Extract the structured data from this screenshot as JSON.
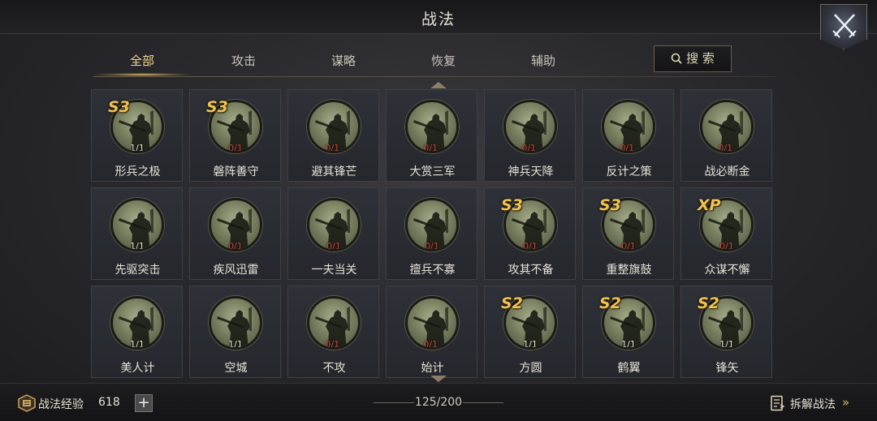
{
  "header": {
    "title": "战法"
  },
  "tabs": [
    {
      "label": "全部",
      "active": true
    },
    {
      "label": "攻击",
      "active": false
    },
    {
      "label": "谋略",
      "active": false
    },
    {
      "label": "恢复",
      "active": false
    },
    {
      "label": "辅助",
      "active": false
    }
  ],
  "search": {
    "label": "搜 索",
    "icon": "search-icon"
  },
  "close": {
    "icon": "crossed-swords-icon"
  },
  "cards": [
    {
      "name": "形兵之极",
      "count": "1/1",
      "badge": "S3"
    },
    {
      "name": "磐阵善守",
      "count": "0/1",
      "badge": "S3"
    },
    {
      "name": "避其锋芒",
      "count": "0/1.",
      "badge": ""
    },
    {
      "name": "大赏三军",
      "count": "0/1.",
      "badge": ""
    },
    {
      "name": "神兵天降",
      "count": "0/1.",
      "badge": ""
    },
    {
      "name": "反计之策",
      "count": "0/1.",
      "badge": ""
    },
    {
      "name": "战必断金",
      "count": "0/1.",
      "badge": ""
    },
    {
      "name": "先驱突击",
      "count": "1/1",
      "badge": ""
    },
    {
      "name": "疾风迅雷",
      "count": "0/1",
      "badge": ""
    },
    {
      "name": "一夫当关",
      "count": "0/1",
      "badge": ""
    },
    {
      "name": "擅兵不寡",
      "count": "0/1",
      "badge": ""
    },
    {
      "name": "攻其不备",
      "count": "0/1",
      "badge": "S3"
    },
    {
      "name": "重整旗鼓",
      "count": "0/1",
      "badge": "S3"
    },
    {
      "name": "众谋不懈",
      "count": "0/1",
      "badge": "XP"
    },
    {
      "name": "美人计",
      "count": "1/1",
      "badge": ""
    },
    {
      "name": "空城",
      "count": "1/1",
      "badge": ""
    },
    {
      "name": "不攻",
      "count": "0/1.",
      "badge": ""
    },
    {
      "name": "始计",
      "count": "0/1.",
      "badge": ""
    },
    {
      "name": "方圆",
      "count": "1/1",
      "badge": "S2"
    },
    {
      "name": "鹤翼",
      "count": "1/1",
      "badge": "S2"
    },
    {
      "name": "锋矢",
      "count": "1/1",
      "badge": "S2"
    }
  ],
  "footer": {
    "exp_label": "战法经验",
    "exp_value": "618",
    "plus_label": "+",
    "capacity": "125/200",
    "decompose_label": "拆解战法",
    "decompose_chevron": "»"
  },
  "colors": {
    "accent_gold": "#f0c152",
    "zero_count_red": "#c8463c",
    "active_tab": "#f4d58a"
  }
}
